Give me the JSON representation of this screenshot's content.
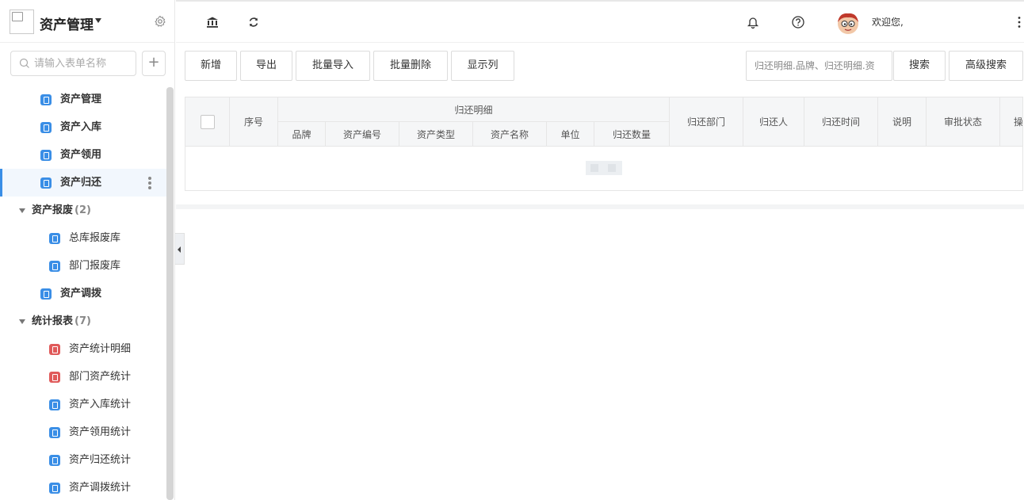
{
  "sidebar": {
    "app_title": "资产管理",
    "search_placeholder": "请输入表单名称",
    "add_label": "+",
    "items": [
      {
        "label": "资产管理",
        "type": "level1",
        "icon_color": "#3a8ee6"
      },
      {
        "label": "资产入库",
        "type": "level1",
        "icon_color": "#3a8ee6"
      },
      {
        "label": "资产领用",
        "type": "level1",
        "icon_color": "#3a8ee6"
      },
      {
        "label": "资产归还",
        "type": "level1",
        "icon_color": "#3a8ee6",
        "active": true
      },
      {
        "label": "资产报废",
        "type": "group",
        "count": "(2)"
      },
      {
        "label": "总库报废库",
        "type": "level2",
        "icon_color": "#3a8ee6"
      },
      {
        "label": "部门报废库",
        "type": "level2",
        "icon_color": "#3a8ee6"
      },
      {
        "label": "资产调拨",
        "type": "level1",
        "icon_color": "#3a8ee6"
      },
      {
        "label": "统计报表",
        "type": "group",
        "count": "(7)"
      },
      {
        "label": "资产统计明细",
        "type": "level2",
        "icon_color": "#e05a5a"
      },
      {
        "label": "部门资产统计",
        "type": "level2",
        "icon_color": "#e05a5a"
      },
      {
        "label": "资产入库统计",
        "type": "level2",
        "icon_color": "#3a8ee6"
      },
      {
        "label": "资产领用统计",
        "type": "level2",
        "icon_color": "#3a8ee6"
      },
      {
        "label": "资产归还统计",
        "type": "level2",
        "icon_color": "#3a8ee6"
      },
      {
        "label": "资产调拨统计",
        "type": "level2",
        "icon_color": "#3a8ee6"
      }
    ]
  },
  "topbar": {
    "welcome": "欢迎您,",
    "icons": [
      "bank-icon",
      "refresh-icon",
      "bell-icon",
      "help-icon",
      "avatar",
      "more-icon"
    ]
  },
  "toolbar": {
    "add": "新增",
    "export": "导出",
    "batch_import": "批量导入",
    "batch_delete": "批量删除",
    "show_columns": "显示列",
    "quick_search": "归还明细.品牌、归还明细.资",
    "search": "搜索",
    "advanced_search": "高级搜索"
  },
  "table": {
    "seq": "序号",
    "group_header": "归还明细",
    "sub_columns": [
      "品牌",
      "资产编号",
      "资产类型",
      "资产名称",
      "单位",
      "归还数量"
    ],
    "columns": [
      "归还部门",
      "归还人",
      "归还时间",
      "说明",
      "审批状态",
      "操"
    ]
  },
  "colors": {
    "accent": "#3a8ee6",
    "red_icon": "#e05a5a",
    "header_bg": "#f5f6f7"
  }
}
